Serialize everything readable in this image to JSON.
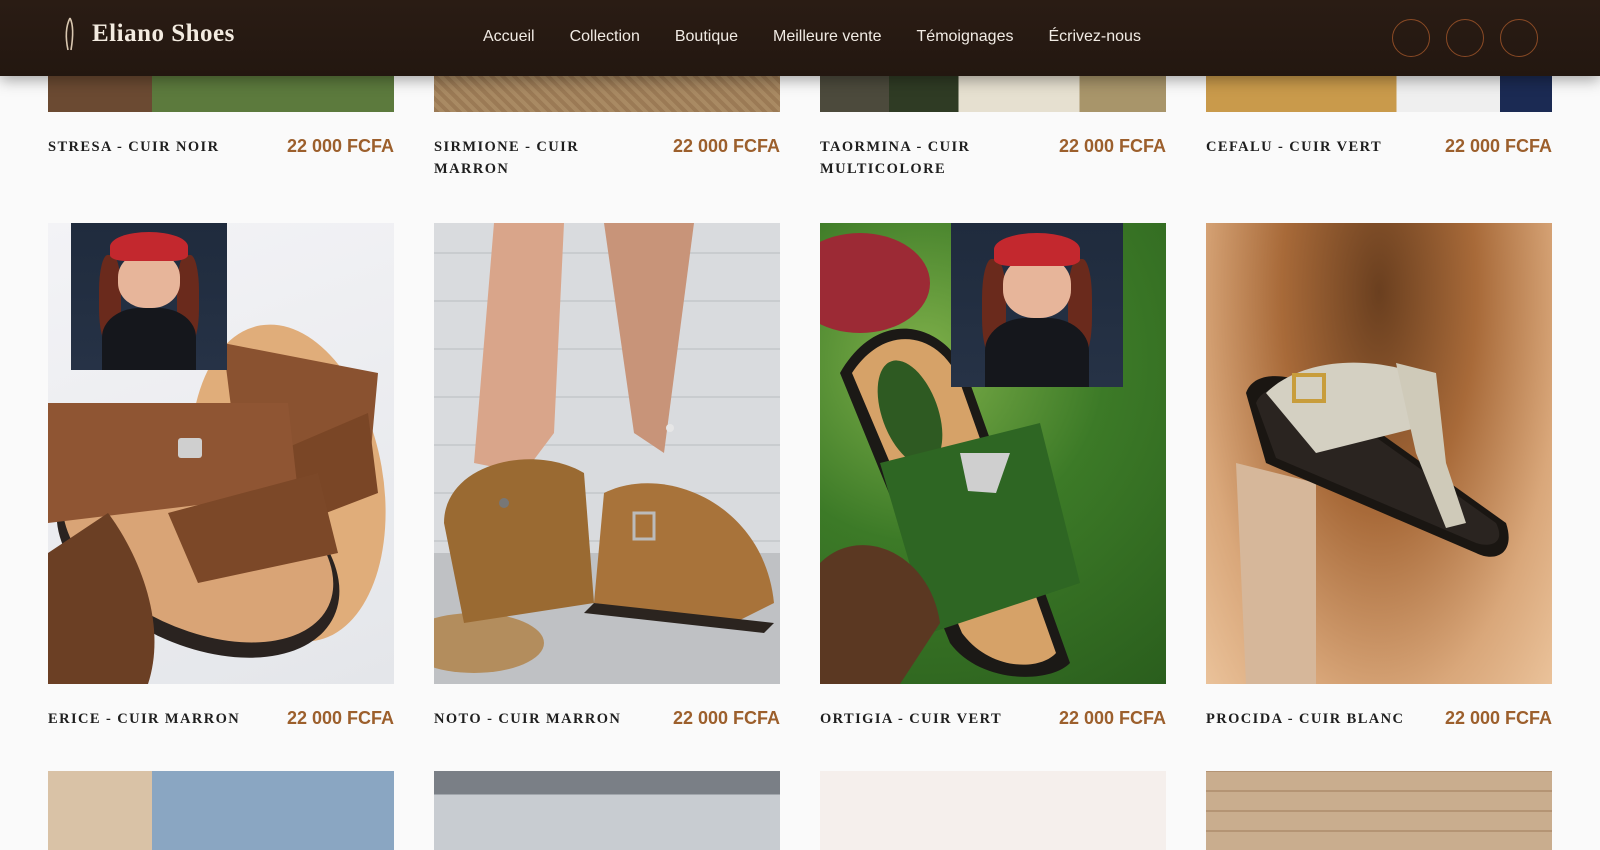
{
  "header": {
    "brand": "Eliano Shoes",
    "nav": [
      "Accueil",
      "Collection",
      "Boutique",
      "Meilleure vente",
      "Témoignages",
      "Écrivez-nous"
    ],
    "icons": [
      "search-icon",
      "user-icon",
      "cart-icon"
    ],
    "accent": "#8a4a25",
    "background": "#241811"
  },
  "products": [
    {
      "name": "STRESA - CUIR NOIR",
      "price": "22 000 FCFA"
    },
    {
      "name": "SIRMIONE - CUIR MARRON",
      "price": "22 000 FCFA"
    },
    {
      "name": "TAORMINA - CUIR MULTICOLORE",
      "price": "22 000 FCFA"
    },
    {
      "name": "CEFALU - CUIR VERT",
      "price": "22 000 FCFA"
    },
    {
      "name": "ERICE - CUIR MARRON",
      "price": "22 000 FCFA"
    },
    {
      "name": "NOTO - CUIR MARRON",
      "price": "22 000 FCFA"
    },
    {
      "name": "ORTIGIA - CUIR VERT",
      "price": "22 000 FCFA"
    },
    {
      "name": "PROCIDA - CUIR BLANC",
      "price": "22 000 FCFA"
    }
  ],
  "price_color": "#9c5f2c"
}
